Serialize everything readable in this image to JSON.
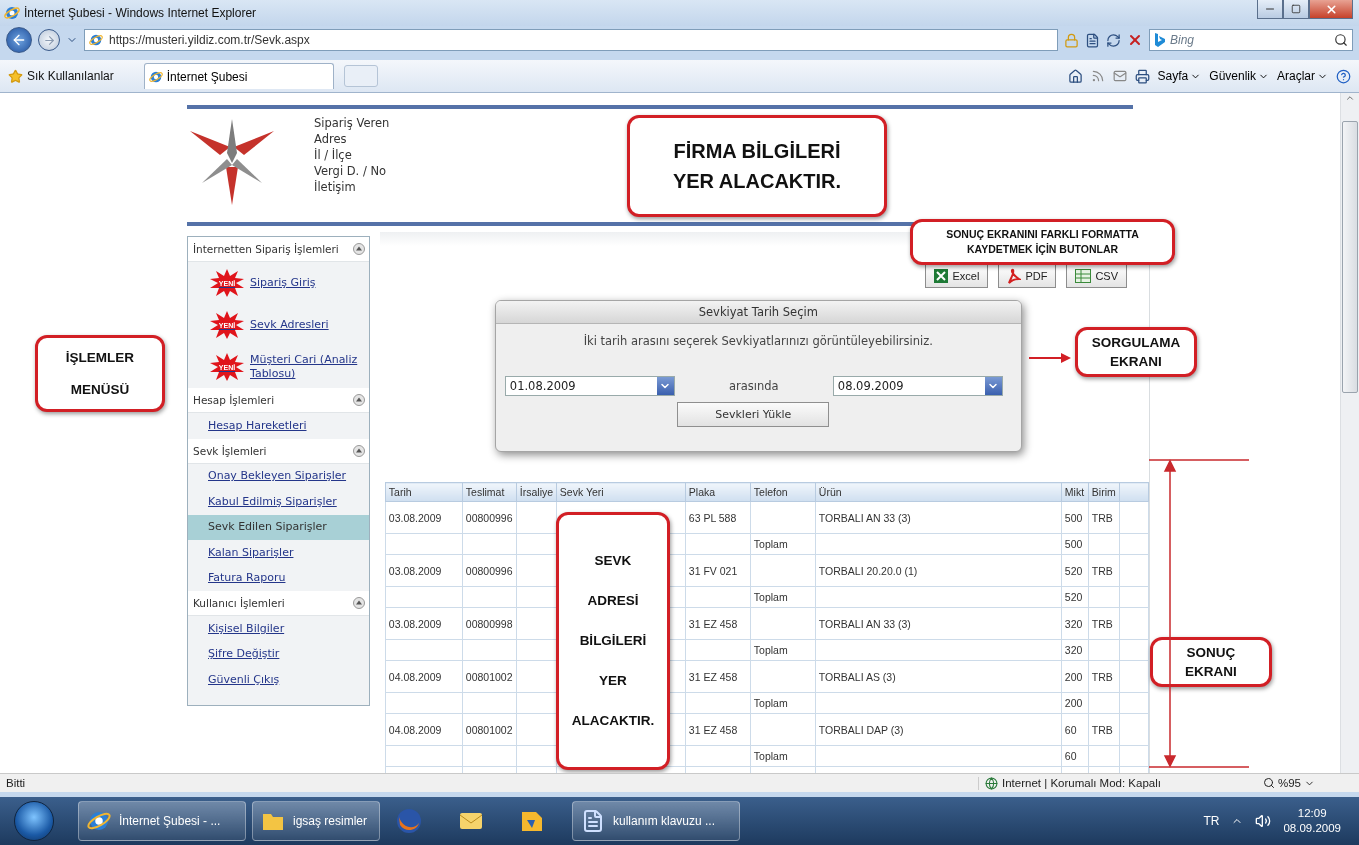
{
  "browser": {
    "title": "İnternet Şubesi - Windows Internet Explorer",
    "address": "https://musteri.yildiz.com.tr/Sevk.aspx",
    "search_placeholder": "Bing",
    "favorites_label": "Sık Kullanılanlar",
    "tabs": [
      {
        "label": "İnternet Şubesi",
        "selected": true
      }
    ],
    "commands": [
      "Sayfa",
      "Güvenlik",
      "Araçlar"
    ]
  },
  "header": {
    "company_fields": [
      "Sipariş Veren",
      "Adres",
      "İl / İlçe",
      "Vergi D. / No",
      "İletişim"
    ]
  },
  "menu": [
    {
      "title": "İnternetten Sipariş İşlemleri",
      "expanded": true,
      "items": [
        {
          "kind": "new",
          "badge": "YENİ",
          "label": "Sipariş Giriş",
          "selected": false
        },
        {
          "kind": "new",
          "badge": "YENİ",
          "label": "Sevk Adresleri",
          "selected": false
        },
        {
          "kind": "new",
          "badge": "YENİ",
          "label": "Müşteri Cari (Analiz Tablosu)",
          "selected": false
        }
      ]
    },
    {
      "title": "Hesap İşlemleri",
      "expanded": true,
      "items": [
        {
          "kind": "link",
          "label": "Hesap Hareketleri",
          "selected": false
        }
      ]
    },
    {
      "title": "Sevk İşlemleri",
      "expanded": true,
      "items": [
        {
          "kind": "link",
          "label": "Onay Bekleyen Siparişler",
          "selected": false
        },
        {
          "kind": "link",
          "label": "Kabul Edilmiş Siparişler",
          "selected": false
        },
        {
          "kind": "link",
          "label": "Sevk Edilen Siparişler",
          "selected": true
        },
        {
          "kind": "link",
          "label": "Kalan Siparişler",
          "selected": false
        },
        {
          "kind": "link",
          "label": "Fatura Raporu",
          "selected": false
        }
      ]
    },
    {
      "title": "Kullanıcı İşlemleri",
      "expanded": true,
      "items": [
        {
          "kind": "link",
          "label": "Kişisel Bilgiler",
          "selected": false
        },
        {
          "kind": "link",
          "label": "Şifre Değiştir",
          "selected": false
        },
        {
          "kind": "link",
          "label": "Güvenli Çıkış",
          "selected": false
        }
      ]
    }
  ],
  "export_buttons": [
    {
      "kind": "excel",
      "label": "Excel"
    },
    {
      "kind": "pdf",
      "label": "PDF"
    },
    {
      "kind": "csv",
      "label": "CSV"
    }
  ],
  "dialog": {
    "title": "Sevkiyat Tarih Seçim",
    "message": "İki tarih arasını seçerek Sevkiyatlarınızı görüntüleyebilirsiniz.",
    "from": "01.08.2009",
    "between": "arasında",
    "to": "08.09.2009",
    "button": "Sevkleri Yükle"
  },
  "table": {
    "columns": [
      "Tarih",
      "Teslimat",
      "İrsaliye",
      "Sevk Yeri",
      "Plaka",
      "Telefon",
      "Ürün",
      "Mikt",
      "Birim"
    ],
    "rows": [
      {
        "kind": "item",
        "date": "03.08.2009",
        "delivery": "00800996",
        "plate": "63 PL 588",
        "product": "TORBALI AN 33 (3)",
        "qty": "500",
        "unit": "TRB"
      },
      {
        "kind": "total",
        "label": "Toplam",
        "qty": "500"
      },
      {
        "kind": "item",
        "date": "03.08.2009",
        "delivery": "00800996",
        "plate": "31 FV 021",
        "product": "TORBALI 20.20.0 (1)",
        "qty": "520",
        "unit": "TRB"
      },
      {
        "kind": "total",
        "label": "Toplam",
        "qty": "520"
      },
      {
        "kind": "item",
        "date": "03.08.2009",
        "delivery": "00800998",
        "plate": "31 EZ 458",
        "product": "TORBALI AN 33 (3)",
        "qty": "320",
        "unit": "TRB"
      },
      {
        "kind": "total",
        "label": "Toplam",
        "qty": "320"
      },
      {
        "kind": "item",
        "date": "04.08.2009",
        "delivery": "00801002",
        "plate": "31 EZ 458",
        "product": "TORBALI AS (3)",
        "qty": "200",
        "unit": "TRB"
      },
      {
        "kind": "total",
        "label": "Toplam",
        "qty": "200"
      },
      {
        "kind": "item",
        "date": "04.08.2009",
        "delivery": "00801002",
        "plate": "31 EZ 458",
        "product": "TORBALI DAP (3)",
        "qty": "60",
        "unit": "TRB"
      },
      {
        "kind": "total",
        "label": "Toplam",
        "qty": "60"
      }
    ]
  },
  "annotations": [
    {
      "kind": "callout",
      "lines": [
        "FİRMA BİLGİLERİ",
        "YER ALACAKTIR."
      ]
    },
    {
      "kind": "callout",
      "lines": [
        "SONUÇ EKRANINI FARKLI FORMATTA",
        "KAYDETMEK İÇİN BUTONLAR"
      ]
    },
    {
      "kind": "arrow",
      "lines": [
        "SORGULAMA",
        "EKRANI"
      ]
    },
    {
      "kind": "callout",
      "lines": [
        "İŞLEMLER",
        "MENÜSÜ"
      ]
    },
    {
      "kind": "callout",
      "lines": [
        "SEVK",
        "ADRESİ",
        "BİLGİLERİ",
        "YER",
        "ALACAKTIR."
      ]
    },
    {
      "kind": "span",
      "lines": [
        "SONUÇ",
        "EKRANI"
      ]
    }
  ],
  "status_bar": {
    "text": "Bitti",
    "zone": "Internet | Korumalı Mod: Kapalı",
    "zoom": "%95"
  },
  "taskbar": {
    "items": [
      {
        "kind": "ie",
        "label": "İnternet Şubesi - ..."
      },
      {
        "kind": "folder",
        "label": "igsaş resimler"
      },
      {
        "kind": "firefox"
      },
      {
        "kind": "mail"
      },
      {
        "kind": "app"
      },
      {
        "kind": "word",
        "label": "kullanım klavuzu ..."
      }
    ],
    "language": "TR",
    "time": "12:09",
    "date": "08.09.2009"
  }
}
